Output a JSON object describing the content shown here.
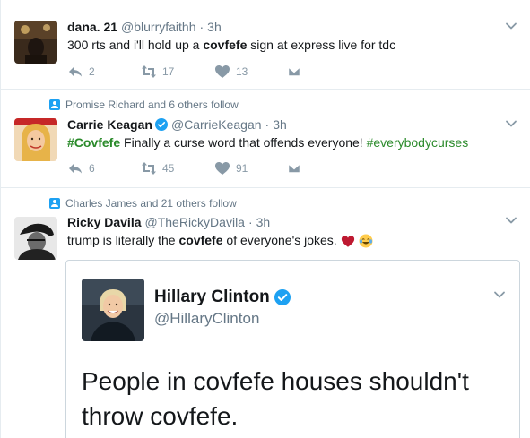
{
  "tweets": [
    {
      "name": "dana. 21",
      "handle": "@blurryfaithh",
      "separator": "·",
      "time": "3h",
      "text_parts": [
        "300 rts and i'll hold up a ",
        "covfefe",
        " sign at express live for tdc"
      ],
      "replies": "2",
      "retweets": "17",
      "likes": "13"
    },
    {
      "context": "Promise Richard and 6 others follow",
      "name": "Carrie Keagan",
      "handle": "@CarrieKeagan",
      "separator": "·",
      "time": "3h",
      "text_parts": [
        "#Covfefe",
        " Finally a curse word that offends everyone! ",
        "#everybodycurses"
      ],
      "replies": "6",
      "retweets": "45",
      "likes": "91"
    },
    {
      "context": "Charles James and 21 others follow",
      "name": "Ricky Davila",
      "handle": "@TheRickyDavila",
      "separator": "·",
      "time": "3h",
      "text_parts": [
        "trump is literally the ",
        "covfefe",
        " of everyone's jokes."
      ],
      "emojis": [
        "heart-emoji",
        "laughing-tears-emoji"
      ],
      "quoted": {
        "name": "Hillary Clinton",
        "handle": "@HillaryClinton",
        "text": "People in covfefe houses shouldn't throw covfefe."
      }
    }
  ],
  "colors": {
    "brand_blue": "#1da1f2",
    "hashtag_green": "#2a8a2a",
    "secondary_text": "#657786",
    "action_gray": "#8899a6"
  }
}
